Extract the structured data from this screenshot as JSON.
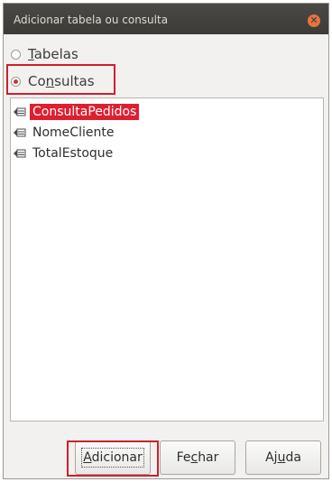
{
  "window": {
    "title": "Adicionar tabela ou consulta",
    "close_symbol": "✕"
  },
  "source_options": {
    "tables": {
      "label_before": "",
      "label_underlined": "T",
      "label_after": "abelas",
      "checked": false
    },
    "queries": {
      "label_before": "Co",
      "label_underlined": "n",
      "label_after": "sultas",
      "checked": true
    }
  },
  "items": [
    {
      "label": "ConsultaPedidos",
      "selected": true,
      "icon": "query-icon"
    },
    {
      "label": "NomeCliente",
      "selected": false,
      "icon": "query-icon"
    },
    {
      "label": "TotalEstoque",
      "selected": false,
      "icon": "query-icon"
    }
  ],
  "buttons": {
    "add": {
      "label_before": "",
      "label_underlined": "A",
      "label_after": "dicionar"
    },
    "close": {
      "label_before": "Fe",
      "label_underlined": "c",
      "label_after": "har"
    },
    "help": {
      "label_before": "Aj",
      "label_underlined": "u",
      "label_after": "da"
    }
  },
  "colors": {
    "accent_highlight": "#d0202a",
    "selection": "#de1f2f",
    "titlebar": "#3c3b37"
  }
}
